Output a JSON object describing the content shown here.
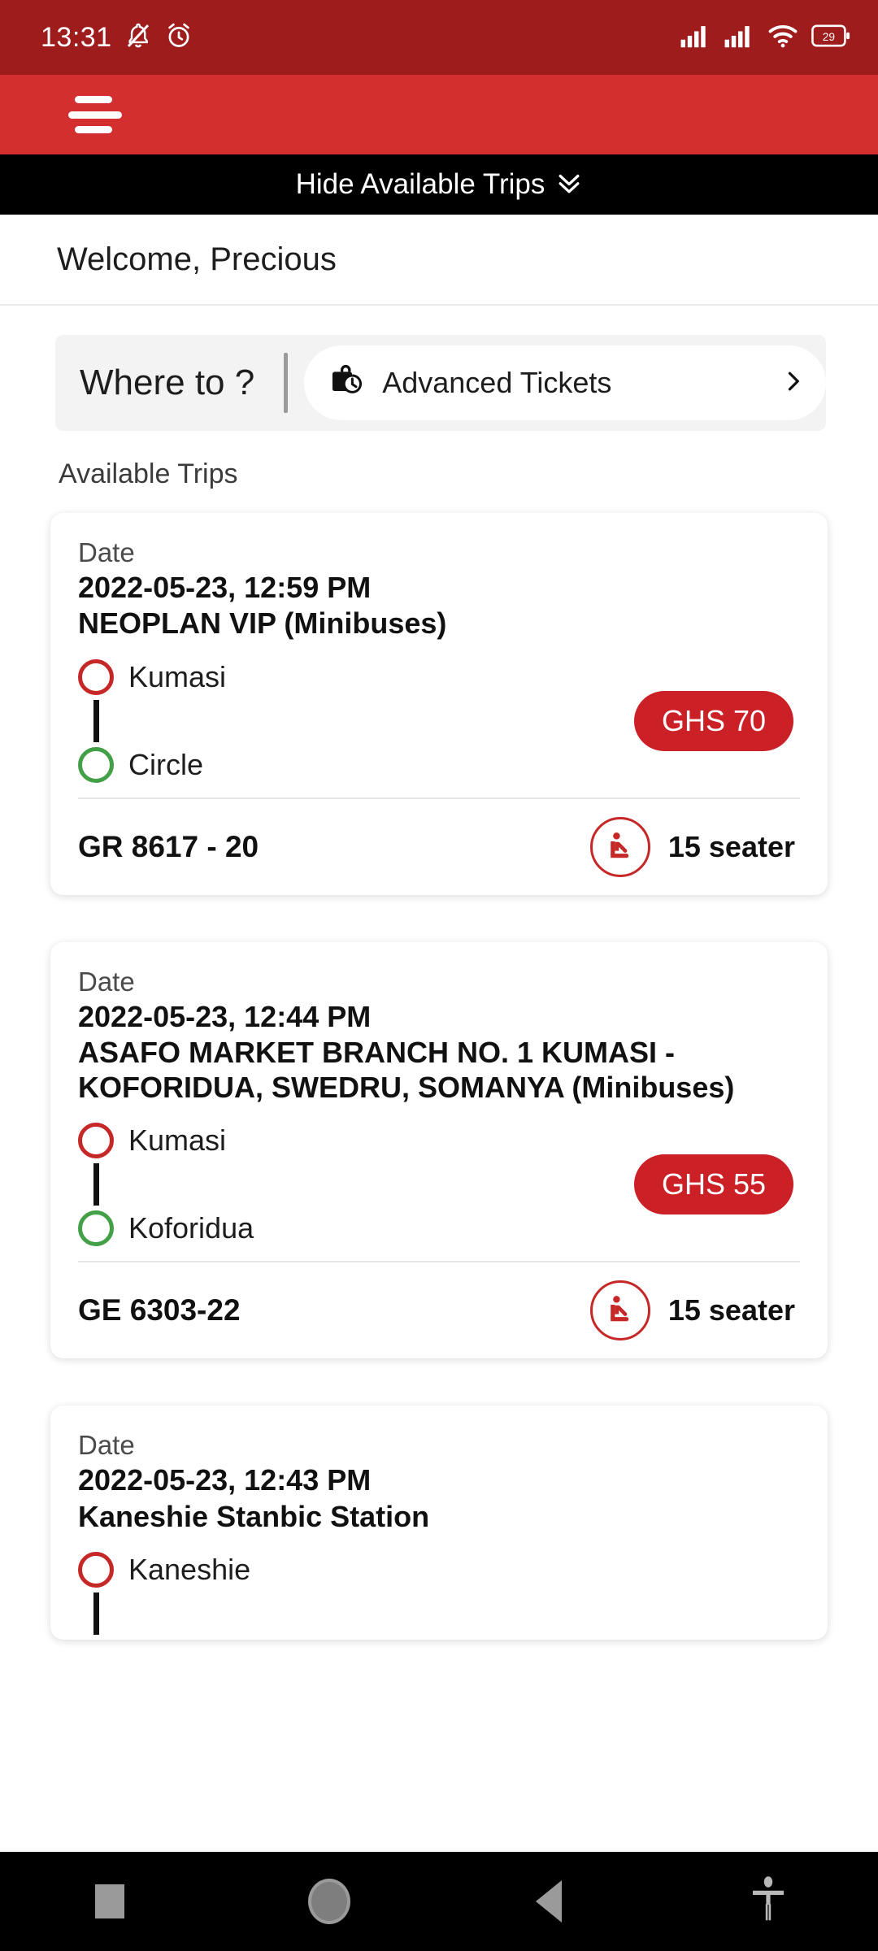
{
  "statusbar": {
    "time": "13:31",
    "icons": [
      "bell-muted-icon",
      "alarm-icon",
      "signal-bars-icon",
      "signal-bars-icon",
      "wifi-icon",
      "battery-icon"
    ],
    "battery_level": "29",
    "bg_color": "#9e1c1c"
  },
  "appbar": {
    "menu_icon": "hamburger-menu-icon",
    "bg_color": "#d32f2f"
  },
  "hide_bar": {
    "label": "Hide Available Trips",
    "chevron_icon": "double-chevron-down-icon",
    "bg_color": "#000000"
  },
  "welcome": {
    "text": "Welcome, Precious"
  },
  "search": {
    "where_to_label": "Where to ?",
    "advanced": {
      "icon": "bag-clock-icon",
      "label": "Advanced Tickets",
      "chevron_icon": "chevron-right-icon"
    }
  },
  "available_trips": {
    "section_label": "Available Trips",
    "date_label": "Date",
    "trips": [
      {
        "date_label": "Date",
        "datetime": "2022-05-23, 12:59 PM",
        "title": "NEOPLAN VIP (Minibuses)",
        "origin": "Kumasi",
        "destination": "Circle",
        "price": "GHS 70",
        "plate": "GR 8617 - 20",
        "capacity": "15 seater",
        "seat_icon": "car-seat-icon"
      },
      {
        "date_label": "Date",
        "datetime": "2022-05-23, 12:44 PM",
        "title": " ASAFO MARKET BRANCH NO. 1 KUMASI - KOFORIDUA, SWEDRU, SOMANYA (Minibuses)",
        "origin": "Kumasi",
        "destination": "Koforidua",
        "price": "GHS 55",
        "plate": "GE 6303-22",
        "capacity": "15 seater",
        "seat_icon": "car-seat-icon"
      },
      {
        "date_label": "Date",
        "datetime": "2022-05-23, 12:43 PM",
        "title": "Kaneshie Stanbic Station",
        "origin": "Kaneshie",
        "destination": "",
        "price": "",
        "plate": "",
        "capacity": "",
        "seat_icon": "car-seat-icon"
      }
    ]
  },
  "navbar": {
    "recents_icon": "square-recents-icon",
    "home_icon": "circle-home-icon",
    "back_icon": "triangle-back-icon",
    "accessibility_icon": "accessibility-icon"
  },
  "colors": {
    "brand_red": "#d32f2f",
    "status_red": "#9e1c1c",
    "price_red": "#cb2026",
    "origin_dot": "#c62828",
    "destination_dot": "#43a047"
  }
}
